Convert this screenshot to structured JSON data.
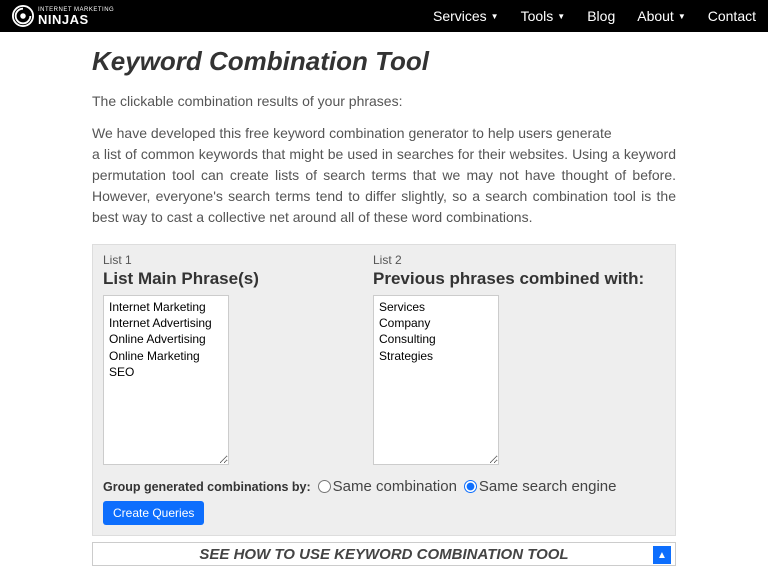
{
  "brand": {
    "top": "INTERNET MARKETING",
    "bottom": "NINJAS"
  },
  "nav": {
    "services": "Services",
    "tools": "Tools",
    "blog": "Blog",
    "about": "About",
    "contact": "Contact"
  },
  "title": "Keyword Combination Tool",
  "intro": "The clickable combination results of your phrases:",
  "desc_line1": "We have developed this free keyword combination generator to help users generate",
  "desc_rest": "a list of common keywords that might be used in searches for their websites. Using a keyword permutation tool can create lists of search terms that we may not have thought of before. However, everyone's search terms tend to differ slightly, so a search combination tool is the best way to cast a collective net around all of these word combinations.",
  "list1": {
    "small": "List 1",
    "heading": "List Main Phrase(s)",
    "value": "Internet Marketing\nInternet Advertising\nOnline Advertising\nOnline Marketing\nSEO"
  },
  "list2": {
    "small": "List 2",
    "heading": "Previous phrases combined with:",
    "value": "Services\nCompany\nConsulting\nStrategies"
  },
  "group": {
    "label": "Group generated combinations by:",
    "opt_same_combo": "Same combination",
    "opt_same_engine": "Same search engine",
    "selected": "same_engine"
  },
  "create_btn": "Create Queries",
  "howto": "SEE HOW TO USE KEYWORD COMBINATION TOOL"
}
